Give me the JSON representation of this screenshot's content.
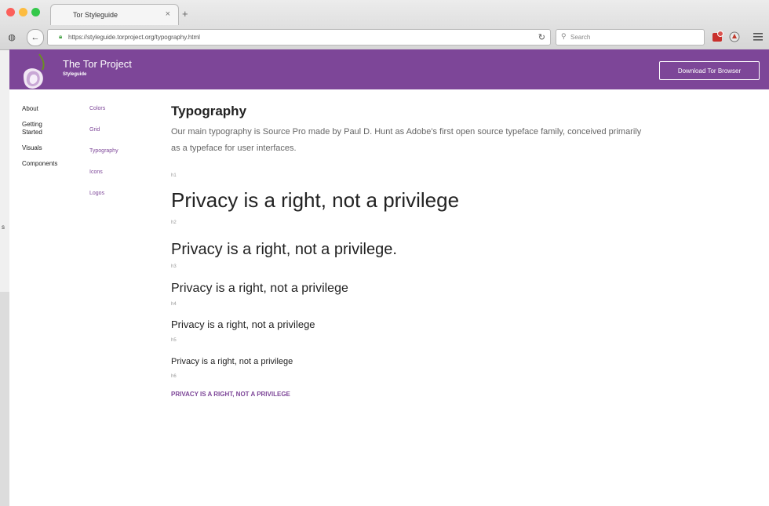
{
  "browser": {
    "tab_title": "Tor Styleguide",
    "new_tab_label": "+",
    "url": "https://styleguide.torproject.org/typography.html",
    "search_placeholder": "Search"
  },
  "header": {
    "title": "The Tor Project",
    "subtitle": "Styleguide",
    "download_button": "Download Tor Browser",
    "brand_color": "#7d4698"
  },
  "side_nav": {
    "items": [
      "About",
      "Getting Started",
      "Visuals",
      "Components"
    ]
  },
  "sub_nav": {
    "items": [
      "Colors",
      "Grid",
      "Typography",
      "Icons",
      "Logos"
    ]
  },
  "main": {
    "title": "Typography",
    "intro": "Our main typography is Source Pro made by Paul D. Hunt as Adobe's first open source typeface family, conceived primarily as a typeface for user interfaces.",
    "samples": [
      {
        "label": "h1",
        "text": "Privacy is a right, not a privilege"
      },
      {
        "label": "h2",
        "text": "Privacy is a right, not a privilege."
      },
      {
        "label": "h3",
        "text": "Privacy is a right, not a privilege"
      },
      {
        "label": "h4",
        "text": "Privacy is a right, not a privilege"
      },
      {
        "label": "h5",
        "text": "Privacy is a right, not a privilege"
      },
      {
        "label": "h6",
        "text": "PRIVACY IS A RIGHT, NOT A PRIVILEGE"
      }
    ]
  },
  "left_edge_text": "s"
}
